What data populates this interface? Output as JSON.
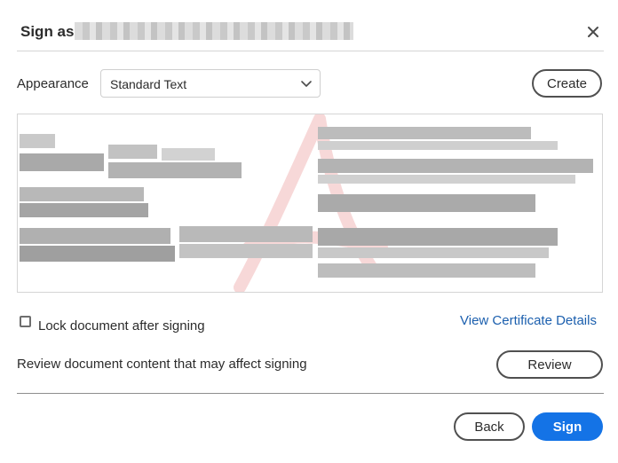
{
  "dialog": {
    "title": "Sign as",
    "close_icon": "close-icon"
  },
  "appearance": {
    "label": "Appearance",
    "selected": "Standard Text",
    "chevron_icon": "chevron-down-icon",
    "create_label": "Create"
  },
  "options": {
    "lock_label": "Lock document after signing",
    "lock_checked": false,
    "certificate_link": "View Certificate Details",
    "review_text": "Review document content that may affect signing",
    "review_label": "Review"
  },
  "footer": {
    "back_label": "Back",
    "sign_label": "Sign"
  },
  "colors": {
    "primary": "#1473e6",
    "link": "#1b5fae",
    "watermark": "#f4c7c7"
  }
}
